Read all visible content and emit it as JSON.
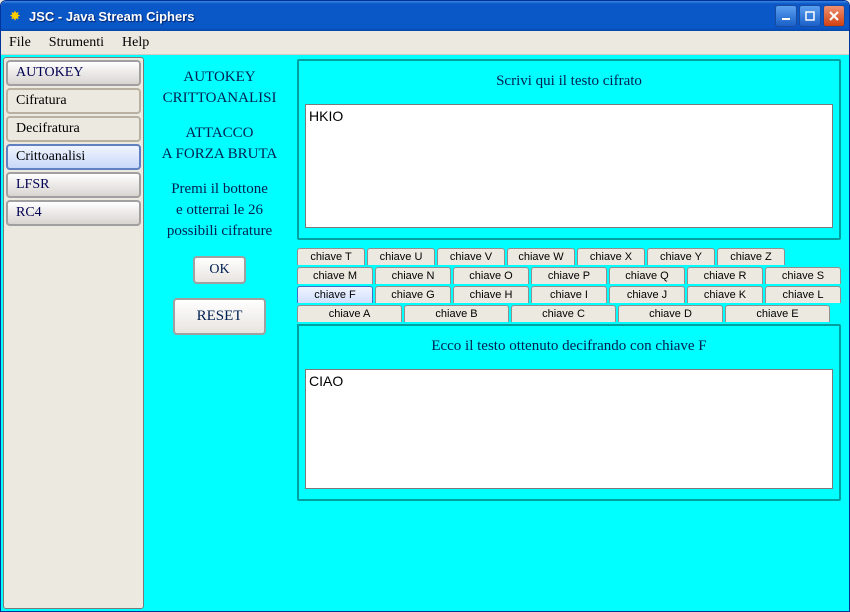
{
  "window": {
    "title": "JSC - Java Stream Ciphers"
  },
  "menu": {
    "file": "File",
    "tools": "Strumenti",
    "help": "Help"
  },
  "sidebar": {
    "items": [
      {
        "label": "AUTOKEY",
        "type": "header"
      },
      {
        "label": "Cifratura",
        "type": "item"
      },
      {
        "label": "Decifratura",
        "type": "item"
      },
      {
        "label": "Crittoanalisi",
        "type": "selected"
      },
      {
        "label": "LFSR",
        "type": "header"
      },
      {
        "label": "RC4",
        "type": "header"
      }
    ]
  },
  "middle": {
    "heading1": "AUTOKEY",
    "heading2": "CRITTOANALISI",
    "sub1": "ATTACCO",
    "sub2": "A FORZA BRUTA",
    "desc1": "Premi il bottone",
    "desc2": "e otterrai le 26",
    "desc3": "possibili cifrature",
    "ok": "OK",
    "reset": "RESET"
  },
  "cipher": {
    "title": "Scrivi qui il testo cifrato",
    "value": "HKIO"
  },
  "tabs": {
    "row1": [
      "chiave T",
      "chiave U",
      "chiave V",
      "chiave W",
      "chiave X",
      "chiave Y",
      "chiave Z"
    ],
    "row2": [
      "chiave M",
      "chiave N",
      "chiave O",
      "chiave P",
      "chiave Q",
      "chiave R",
      "chiave S"
    ],
    "row3": [
      "chiave F",
      "chiave G",
      "chiave H",
      "chiave I",
      "chiave J",
      "chiave K",
      "chiave L"
    ],
    "row4": [
      "chiave A",
      "chiave B",
      "chiave C",
      "chiave D",
      "chiave E"
    ],
    "active": "chiave F"
  },
  "result": {
    "title": "Ecco il testo ottenuto decifrando con chiave F",
    "value": "CIAO"
  }
}
